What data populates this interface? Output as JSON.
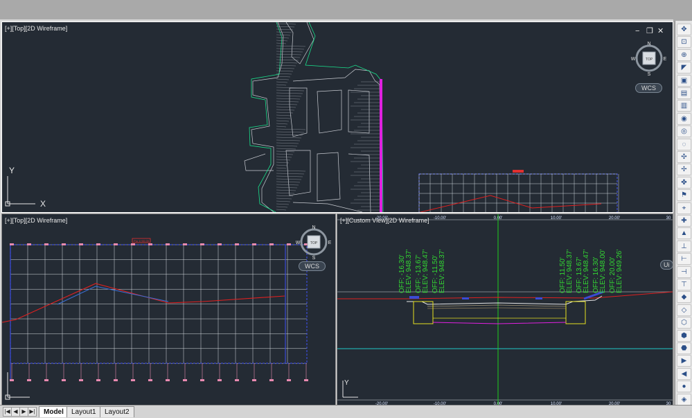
{
  "viewports": {
    "top": {
      "label": "[+][Top][2D Wireframe]"
    },
    "bottom_left": {
      "label": "[+][Top][2D Wireframe]"
    },
    "bottom_right": {
      "label": "[+][Custom View][2D Wireframe]"
    }
  },
  "window_controls": {
    "minimize": "−",
    "restore": "❐",
    "close": "✕"
  },
  "navcube": {
    "face": "TOP",
    "north": "N",
    "south": "S",
    "east": "E",
    "west": "W"
  },
  "wcs_label": "WCS",
  "ucs": {
    "x": "X",
    "y": "Y"
  },
  "section_axis": {
    "top_ticks": [
      "-20.00'",
      "-10.00'",
      "0.00'",
      "10.00'",
      "20.00'"
    ],
    "bottom_ticks": [
      "-20.00'",
      "-10.00'",
      "0.00'",
      "10.00'",
      "20.00'"
    ],
    "edge_tick_top": "30",
    "edge_tick_bottom": "30"
  },
  "section_labels": {
    "left": [
      [
        "OFF: -16.30'",
        "ELEV: 948.37'"
      ],
      [
        "OFF: -13.67'",
        "ELEV: 948.47'"
      ],
      [
        "OFF: -11.50'",
        "ELEV: 948.37'"
      ]
    ],
    "right": [
      [
        "OFF: 11.50'",
        "ELEV: 948.37'"
      ],
      [
        "OFF: 13.67'",
        "ELEV: 948.47'"
      ],
      [
        "OFF: 16.30'",
        "ELEV: 948.00'"
      ],
      [
        "OFF: 20.00'",
        "ELEV: 949.26'"
      ]
    ]
  },
  "profile_badge": "Pro 1+00.00",
  "vp3_edge_text": "Ui",
  "toolbar_icons": [
    "pan-icon",
    "zoom-window-icon",
    "zoom-realtime-icon",
    "zoom-previous-icon",
    "zoom-extents-icon",
    "new-layout-icon",
    "view-manager-icon",
    "orbit-icon",
    "free-orbit-icon",
    "continuous-orbit-icon",
    "swivel-icon",
    "walk-icon",
    "fly-icon",
    "look-icon",
    "camera-icon",
    "zoom-in-icon",
    "zoom-out-icon",
    "ucs-icon",
    "ucs-world-icon",
    "ucs-object-icon",
    "ucs-face-icon",
    "ucs-view-icon",
    "ucs-origin-icon",
    "ucs-zaxis-icon",
    "ucs-3point-icon",
    "ucs-x-icon",
    "ucs-y-icon",
    "ucs-z-icon",
    "render-icon",
    "materials-icon"
  ],
  "toolbar_glyphs": [
    "✥",
    "⊡",
    "⊕",
    "◤",
    "▣",
    "▤",
    "▥",
    "◉",
    "◎",
    "◌",
    "✣",
    "✢",
    "✤",
    "⚑",
    "⌖",
    "✚",
    "▲",
    "⊥",
    "⊢",
    "⊣",
    "⊤",
    "◆",
    "◇",
    "⬡",
    "⬢",
    "⬣",
    "▶",
    "◀",
    "●",
    "◈"
  ],
  "tabs": {
    "model": "Model",
    "layout1": "Layout1",
    "layout2": "Layout2"
  },
  "tab_nav": [
    "|◀",
    "◀",
    "▶",
    "▶|"
  ]
}
